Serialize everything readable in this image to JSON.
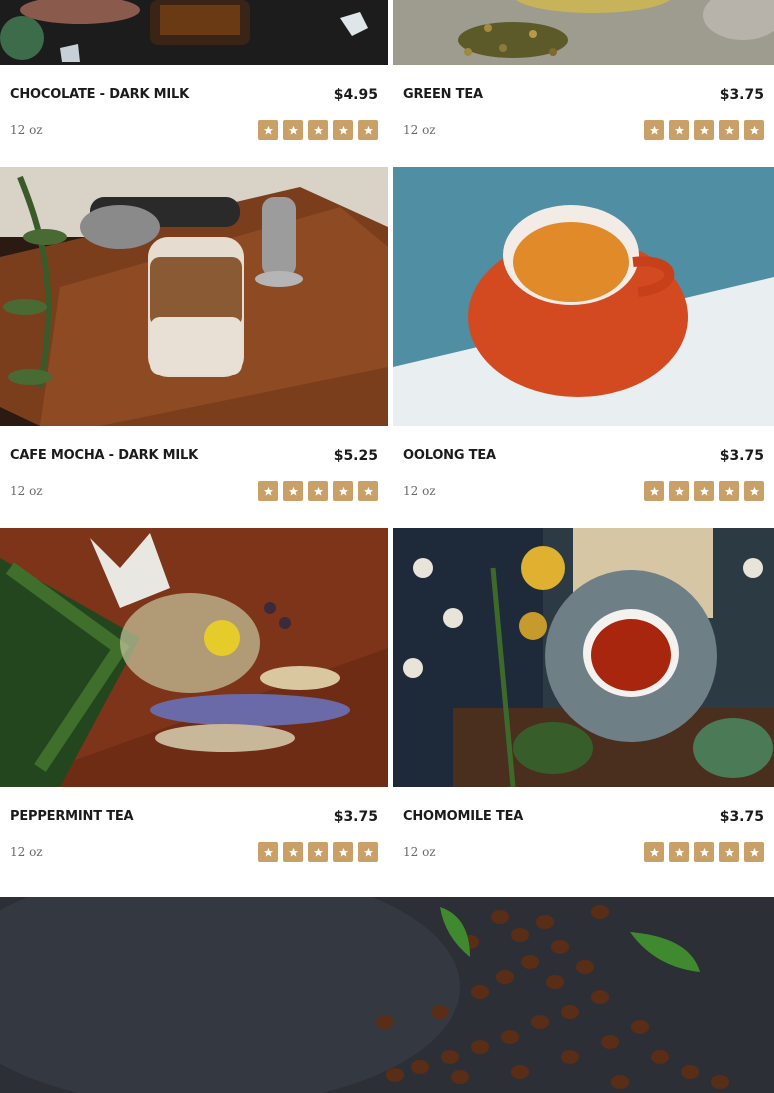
{
  "colors": {
    "star": "#c9a067",
    "text": "#1b1b1b",
    "muted": "#6a6a6a"
  },
  "products": [
    {
      "name": "CHOCOLATE - DARK MILK",
      "price": "$4.95",
      "size": "12 oz",
      "rating": 5,
      "image": "chocolate-drink-photo"
    },
    {
      "name": "GREEN TEA",
      "price": "$3.75",
      "size": "12 oz",
      "rating": 5,
      "image": "dried-tea-flowers-photo"
    },
    {
      "name": "CAFE MOCHA - DARK MILK",
      "price": "$5.25",
      "size": "12 oz",
      "rating": 5,
      "image": "iced-mocha-photo"
    },
    {
      "name": "OOLONG TEA",
      "price": "$3.75",
      "size": "12 oz",
      "rating": 5,
      "image": "red-teacup-photo"
    },
    {
      "name": "PEPPERMINT TEA",
      "price": "$3.75",
      "size": "12 oz",
      "rating": 5,
      "image": "herbal-tea-cup-photo"
    },
    {
      "name": "CHOMOMILE TEA",
      "price": "$3.75",
      "size": "12 oz",
      "rating": 5,
      "image": "tea-cup-sunflowers-photo"
    }
  ],
  "hero": {
    "image": "coffee-beans-photo"
  }
}
